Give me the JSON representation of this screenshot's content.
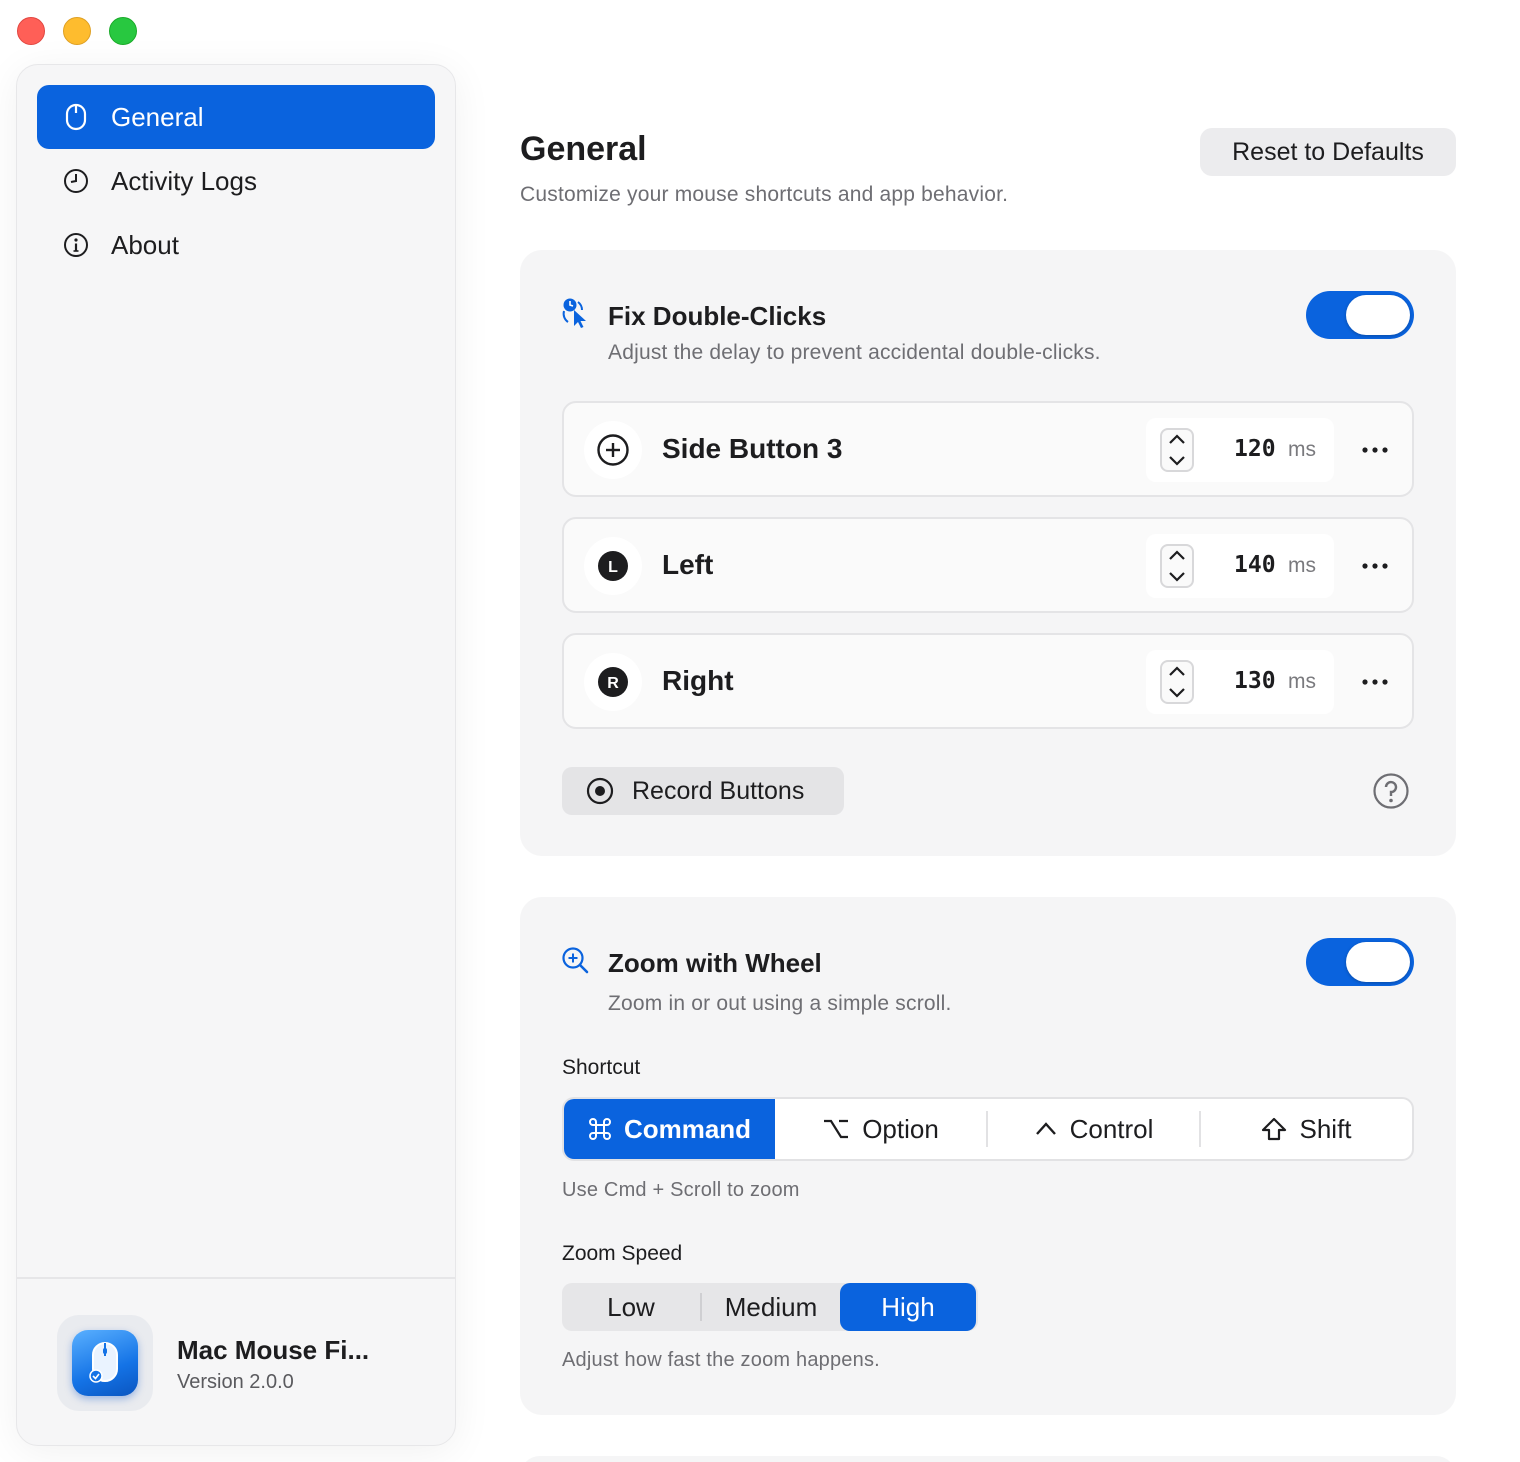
{
  "window": {
    "controls": [
      "close",
      "minimize",
      "zoom"
    ]
  },
  "sidebar": {
    "items": [
      {
        "label": "General",
        "icon": "mouse-icon",
        "active": true
      },
      {
        "label": "Activity Logs",
        "icon": "clock-icon",
        "active": false
      },
      {
        "label": "About",
        "icon": "info-icon",
        "active": false
      }
    ],
    "app": {
      "name": "Mac Mouse Fi...",
      "version": "Version 2.0.0",
      "icon": "mouse-app-icon"
    }
  },
  "header": {
    "title": "General",
    "subtitle": "Customize your mouse shortcuts and app behavior.",
    "reset_label": "Reset to Defaults"
  },
  "fix_double_clicks": {
    "title": "Fix Double-Clicks",
    "description": "Adjust the delay to prevent accidental double-clicks.",
    "enabled": true,
    "buttons": [
      {
        "label": "Side Button 3",
        "badge": "+",
        "value": "120",
        "unit": "ms"
      },
      {
        "label": "Left",
        "badge": "L",
        "value": "140",
        "unit": "ms"
      },
      {
        "label": "Right",
        "badge": "R",
        "value": "130",
        "unit": "ms"
      }
    ],
    "record_label": "Record Buttons"
  },
  "zoom_with_wheel": {
    "title": "Zoom with Wheel",
    "description": "Zoom in or out using a simple scroll.",
    "enabled": true,
    "shortcut_label": "Shortcut",
    "shortcut_options": [
      {
        "label": "Command",
        "icon": "command-icon",
        "selected": true
      },
      {
        "label": "Option",
        "icon": "option-icon",
        "selected": false
      },
      {
        "label": "Control",
        "icon": "control-icon",
        "selected": false
      },
      {
        "label": "Shift",
        "icon": "shift-icon",
        "selected": false
      }
    ],
    "shortcut_hint": "Use Cmd + Scroll to zoom",
    "speed_label": "Zoom Speed",
    "speed_options": [
      {
        "label": "Low",
        "selected": false
      },
      {
        "label": "Medium",
        "selected": false
      },
      {
        "label": "High",
        "selected": true
      }
    ],
    "speed_hint": "Adjust how fast the zoom happens."
  },
  "colors": {
    "accent": "#0a63de",
    "window_background": "#ffffff",
    "card_background": "#f5f5f6",
    "secondary_text": "#6e6e73"
  }
}
